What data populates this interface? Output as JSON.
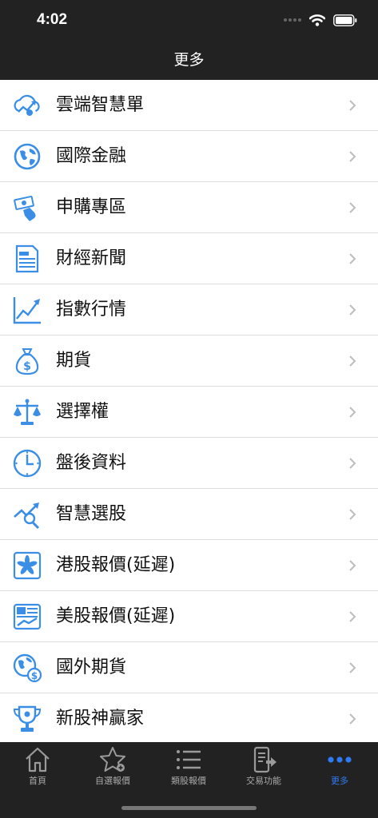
{
  "status_bar": {
    "time": "4:02"
  },
  "nav": {
    "title": "更多"
  },
  "menu": {
    "items": [
      {
        "label": "雲端智慧單",
        "icon": "cloud-chart-icon"
      },
      {
        "label": "國際金融",
        "icon": "globe-icon"
      },
      {
        "label": "申購專區",
        "icon": "money-hand-icon"
      },
      {
        "label": "財經新聞",
        "icon": "newspaper-icon"
      },
      {
        "label": "指數行情",
        "icon": "line-chart-icon"
      },
      {
        "label": "期貨",
        "icon": "money-bag-icon"
      },
      {
        "label": "選擇權",
        "icon": "scales-icon"
      },
      {
        "label": "盤後資料",
        "icon": "clock-icon"
      },
      {
        "label": "智慧選股",
        "icon": "trend-magnifier-icon"
      },
      {
        "label": "港股報價(延遲)",
        "icon": "hk-flag-icon"
      },
      {
        "label": "美股報價(延遲)",
        "icon": "us-flag-icon"
      },
      {
        "label": "國外期貨",
        "icon": "globe-dollar-icon"
      },
      {
        "label": "新股神贏家",
        "icon": "trophy-icon"
      }
    ]
  },
  "tabs": [
    {
      "label": "首頁",
      "icon": "home-icon",
      "active": false
    },
    {
      "label": "自選報價",
      "icon": "star-icon",
      "active": false
    },
    {
      "label": "類股報價",
      "icon": "list-icon",
      "active": false
    },
    {
      "label": "交易功能",
      "icon": "phone-trade-icon",
      "active": false
    },
    {
      "label": "更多",
      "icon": "more-dots-icon",
      "active": true
    }
  ],
  "colors": {
    "accent": "#2f7bf5",
    "icon_blue": "#3a8ee6",
    "bar_bg": "#222222"
  }
}
